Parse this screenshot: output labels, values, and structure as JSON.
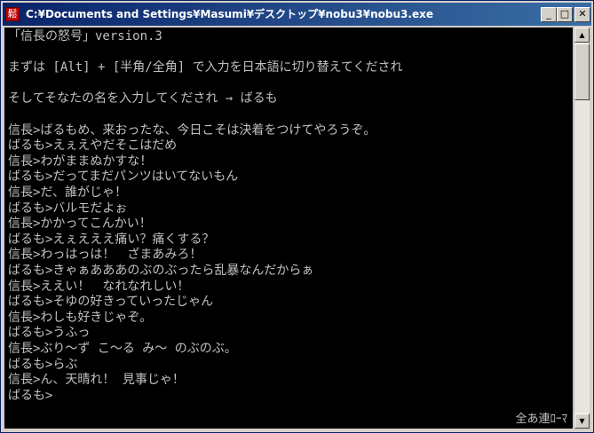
{
  "window": {
    "title": "C:¥Documents and Settings¥Masumi¥デスクトップ¥nobu3¥nobu3.exe",
    "app_icon": "鬆",
    "buttons": {
      "minimize": "_",
      "maximize": "□",
      "close": "✕"
    }
  },
  "console": {
    "lines": [
      "「信長の怒号」version.3",
      "",
      "まずは [Alt] + [半角/全角] で入力を日本語に切り替えてくだされ",
      "",
      "そしてそなたの名を入力してくだされ → ばるも",
      "",
      "信長>ばるもめ、来おったな、今日こそは決着をつけてやろうぞ。",
      "ばるも>えぇえやだそこはだめ",
      "信長>わがままぬかすな！",
      "ばるも>だってまだパンツはいてないもん",
      "信長>だ、誰がじゃ！",
      "ばるも>バルモだよぉ",
      "信長>かかってこんかい！",
      "ばるも>えぇえええ痛い？痛くする？",
      "信長>わっはっは！　ざまあみろ！",
      "ばるも>きゃぁあああのぶのぶったら乱暴なんだからぁ",
      "信長>ええい！　なれなれしい！",
      "ばるも>そゆの好きっていったじゃん",
      "信長>わしも好きじゃぞ。",
      "ばるも>うふっ",
      "信長>ぶり～ず こ～る み～ のぶのぶ。",
      "ばるも>らぶ",
      "信長>ん、天晴れ！ 見事じゃ！",
      "ばるも>"
    ],
    "ime_status": "全あ連ﾛｰﾏ"
  },
  "scrollbar": {
    "up_arrow": "▲",
    "down_arrow": "▼"
  }
}
